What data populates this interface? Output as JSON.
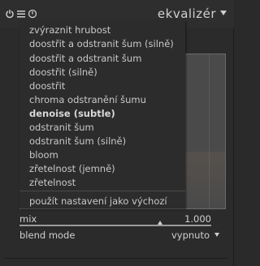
{
  "header": {
    "title": "ekvalizér",
    "icons": [
      "power-icon",
      "presets-menu-icon",
      "reset-icon",
      "collapse-arrow-icon"
    ]
  },
  "menu": {
    "items": [
      {
        "label": "zvýraznit hrubost",
        "bold": false
      },
      {
        "label": "doostřit a odstranit šum (silně)",
        "bold": false
      },
      {
        "label": "doostřit a odstranit šum",
        "bold": false
      },
      {
        "label": "doostřit (silně)",
        "bold": false
      },
      {
        "label": "doostřit",
        "bold": false
      },
      {
        "label": "chroma odstranění šumu",
        "bold": false
      },
      {
        "label": "denoise (subtle)",
        "bold": true
      },
      {
        "label": "odstranit šum",
        "bold": false
      },
      {
        "label": "odstranit šum (silně)",
        "bold": false
      },
      {
        "label": "bloom",
        "bold": false
      },
      {
        "label": "zřetelnost (jemně)",
        "bold": false
      },
      {
        "label": "zřetelnost",
        "bold": false
      }
    ],
    "default_action": "použít nastavení jako výchozí"
  },
  "controls": {
    "mix_label": "mix",
    "mix_value": "1.000",
    "mix_level": 1.0,
    "blend_label": "blend mode",
    "blend_value": "vypnuto"
  },
  "colors": {
    "background": "#2b2b2b",
    "menu_background": "#2c2c2c",
    "text": "#cfcfcf"
  }
}
